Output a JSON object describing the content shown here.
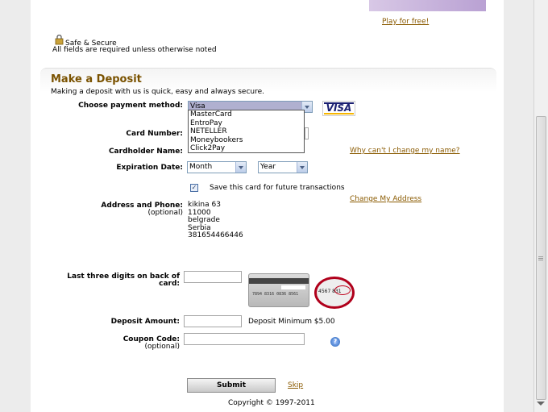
{
  "header": {
    "play_link": "Play for free!",
    "secure_label": "Safe & Secure",
    "required_note": "All fields are required unless otherwise noted"
  },
  "deposit": {
    "title": "Make a Deposit",
    "subtitle": "Making a deposit with us is quick, easy and always secure.",
    "payment_method_label": "Choose payment method:",
    "payment_selected": "Visa",
    "payment_options": [
      "MasterCard",
      "EntroPay",
      "NETELLER",
      "Moneybookers",
      "Click2Pay"
    ],
    "visa_logo": "VISA",
    "card_number_label": "Card Number:",
    "cardholder_label": "Cardholder Name:",
    "name_change_link": "Why can't I change my name?",
    "expiration_label": "Expiration Date:",
    "month_value": "Month",
    "year_value": "Year",
    "save_card_label": "Save this card for future transactions",
    "save_card_checked": true,
    "change_address_link": "Change My Address",
    "address_label": "Address and Phone:",
    "address_optional": "(optional)",
    "address_lines": [
      "kikina 63",
      "11000",
      "belgrade",
      "Serbia",
      "381654466446"
    ],
    "cvv_label": "Last three digits on back of",
    "cvv_label2": "card:",
    "card_numbers_text": "7894 8316 0836 8561",
    "zoom_text": "4567 831",
    "deposit_amount_label": "Deposit Amount:",
    "deposit_minimum": "Deposit Minimum $5.00",
    "coupon_label": "Coupon Code:",
    "coupon_optional": "(optional)",
    "help_icon_text": "?",
    "submit_label": "Submit",
    "skip_link": "Skip"
  },
  "footer": {
    "copyright": "Copyright © 1997-2011"
  },
  "colors": {
    "accent": "#7a5200",
    "link": "#8a5a00",
    "selection": "#b0b0d0"
  }
}
